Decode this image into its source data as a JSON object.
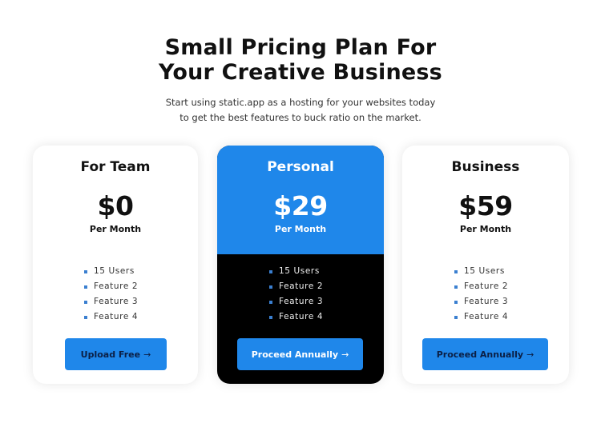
{
  "header": {
    "title_line1": "Small Pricing Plan For",
    "title_line2": "Your Creative Business",
    "subtitle_line1": "Start using static.app as a hosting for your websites today",
    "subtitle_line2": "to get the best features to buck ratio on the market."
  },
  "colors": {
    "accent": "#1f87ea",
    "highlight_card_bottom": "#000000",
    "bullet": "#3a7fd0"
  },
  "plans": [
    {
      "name": "For Team",
      "price": "$0",
      "period": "Per Month",
      "features": [
        "15 Users",
        "Feature 2",
        "Feature 3",
        "Feature 4"
      ],
      "button_label": "Upload Free",
      "button_icon": "→"
    },
    {
      "name": "Personal",
      "price": "$29",
      "period": "Per Month",
      "features": [
        "15 Users",
        "Feature 2",
        "Feature 3",
        "Feature 4"
      ],
      "button_label": "Proceed Annually",
      "button_icon": "→"
    },
    {
      "name": "Business",
      "price": "$59",
      "period": "Per Month",
      "features": [
        "15 Users",
        "Feature 2",
        "Feature 3",
        "Feature 4"
      ],
      "button_label": "Proceed Annually",
      "button_icon": "→"
    }
  ]
}
